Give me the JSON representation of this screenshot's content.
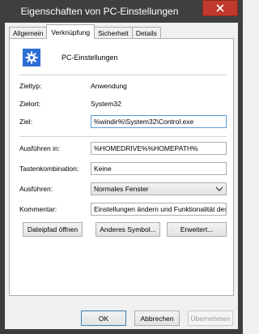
{
  "window": {
    "title": "Eigenschaften von PC-Einstellungen"
  },
  "tabs": [
    {
      "label": "Allgemein"
    },
    {
      "label": "Verknüpfung"
    },
    {
      "label": "Sicherheit"
    },
    {
      "label": "Details"
    }
  ],
  "shortcut": {
    "name": "PC-Einstellungen",
    "icon": "gear-icon",
    "icon_color": "#2d6fd6",
    "type_label": "Zieltyp:",
    "type_value": "Anwendung",
    "location_label": "Zielort:",
    "location_value": "System32",
    "target_label": "Ziel:",
    "target_value": "%windir%\\System32\\Control.exe",
    "start_in_label": "Ausführen in:",
    "start_in_value": "%HOMEDRIVE%%HOMEPATH%",
    "hotkey_label": "Tastenkombination:",
    "hotkey_value": "Keine",
    "run_label": "Ausführen:",
    "run_value": "Normales Fenster",
    "comment_label": "Kommentar:",
    "comment_value": "Einstellungen ändern und Funktionalität des"
  },
  "actions": {
    "open_path": "Dateipfad öffnen",
    "change_icon": "Anderes Symbol...",
    "advanced": "Erweitert..."
  },
  "footer": {
    "ok": "OK",
    "cancel": "Abbrechen",
    "apply": "Übernehmen"
  }
}
